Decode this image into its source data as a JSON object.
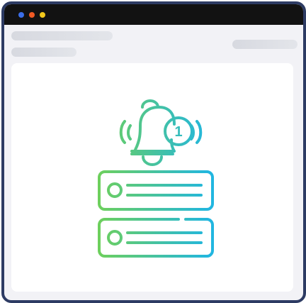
{
  "window": {
    "controls": [
      "close-dot",
      "minimize-dot",
      "zoom-dot"
    ],
    "control_colors": [
      "#3b6ee8",
      "#f05a24",
      "#f2c81c"
    ]
  },
  "colors": {
    "frame_border": "#2d3b63",
    "titlebar": "#121212",
    "background": "#f2f2f6",
    "panel": "#ffffff",
    "skeleton": "#d7d9e0",
    "gradient_start": "#6fd05a",
    "gradient_end": "#21b6e0"
  },
  "notification": {
    "badge_count": "1"
  },
  "illustration": {
    "icons": [
      "bell-icon",
      "notification-list-icon"
    ]
  }
}
